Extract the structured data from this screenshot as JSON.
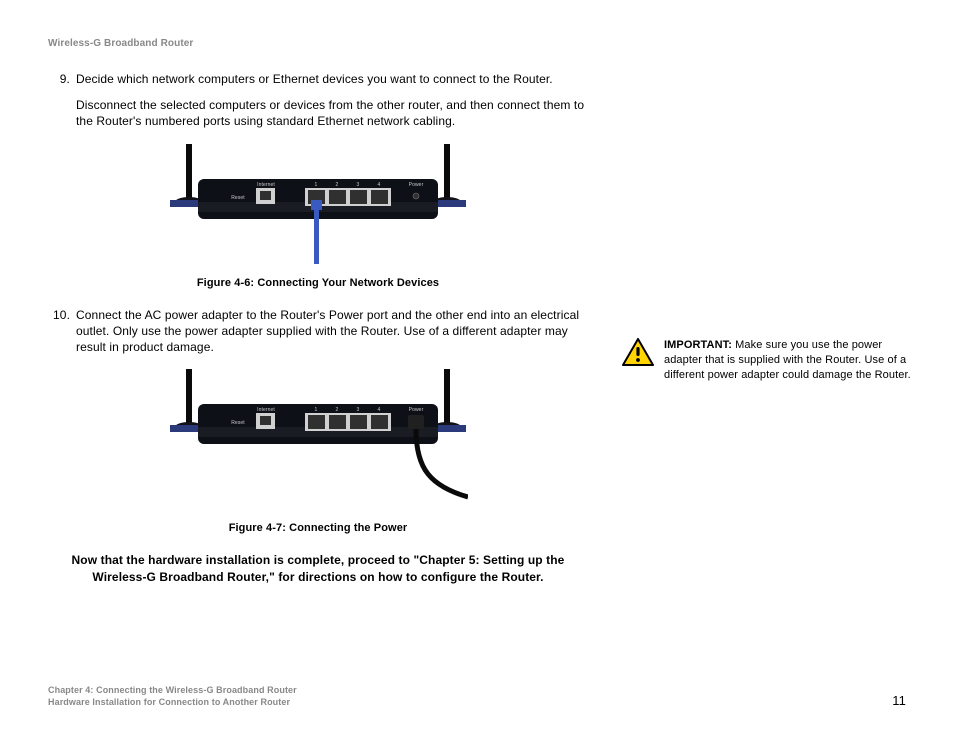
{
  "header": {
    "title": "Wireless-G Broadband Router"
  },
  "steps": {
    "s9": {
      "num": "9.",
      "p1": "Decide which network computers or Ethernet devices you want to connect to the Router.",
      "p2": "Disconnect the selected computers or devices from the other router, and then connect them to the Router's numbered ports using standard Ethernet network cabling."
    },
    "s10": {
      "num": "10.",
      "p1": "Connect the AC power adapter to the Router's Power port and the other end into an electrical outlet. Only use the power adapter supplied with the Router. Use of a different adapter may result in product damage."
    }
  },
  "figures": {
    "f46": "Figure 4-6: Connecting Your Network Devices",
    "f47": "Figure 4-7: Connecting the Power"
  },
  "router_labels": {
    "reset": "Reset",
    "internet": "Internet",
    "p1": "1",
    "p2": "2",
    "p3": "3",
    "p4": "4",
    "power": "Power"
  },
  "conclude": "Now that the hardware installation is complete, proceed to \"Chapter 5: Setting up the Wireless-G Broadband Router,\" for directions on how to configure the Router.",
  "important": {
    "label": "IMPORTANT:",
    "text": " Make sure you use the power adapter that is supplied with the Router. Use of a different power adapter could damage the Router."
  },
  "footer": {
    "line1": "Chapter 4: Connecting the Wireless-G Broadband Router",
    "line2": "Hardware Installation for Connection to Another Router",
    "page": "11"
  }
}
